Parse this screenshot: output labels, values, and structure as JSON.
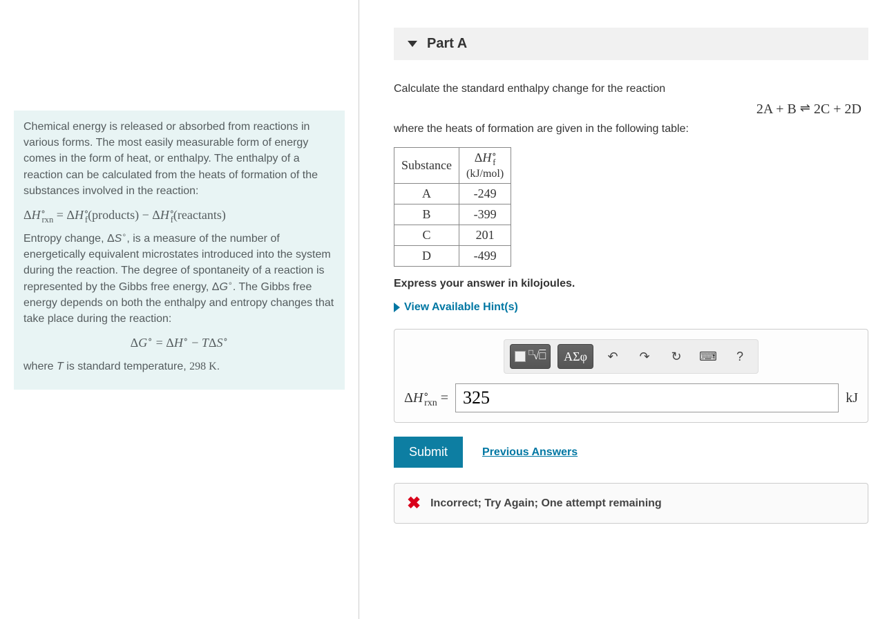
{
  "left": {
    "para1_a": "Chemical energy is released or absorbed from reactions in various forms. The most easily measurable form of energy comes in the form of heat, or enthalpy. The enthalpy of a reaction can be calculated from the heats of formation of the substances involved in the reaction:",
    "eq1": "ΔH°_rxn = ΔH°_f(products) − ΔH°_f(reactants)",
    "para2_a": "Entropy change, ",
    "para2_b": ", is a measure of the number of energetically equivalent microstates introduced into the system during the reaction. The degree of spontaneity of a reaction is represented by the Gibbs free energy, ",
    "para2_c": ". The Gibbs free energy depends on both the enthalpy and entropy changes that take place during the reaction:",
    "eq2": "ΔG° = ΔH° − TΔS°",
    "para3_a": "where ",
    "para3_b": " is standard temperature, ",
    "para3_c": "298 K",
    "para3_d": "."
  },
  "part": {
    "label": "Part A",
    "prompt_a": "Calculate the standard enthalpy change for the reaction",
    "equation": "2A + B ⇌ 2C + 2D",
    "prompt_b": "where the heats of formation are given in the following table:",
    "table": {
      "hdr_sub": "Substance",
      "hdr_val_sym": "ΔH°_f",
      "hdr_val_unit": "(kJ/mol)",
      "rows": [
        {
          "s": "A",
          "v": "-249"
        },
        {
          "s": "B",
          "v": "-399"
        },
        {
          "s": "C",
          "v": "201"
        },
        {
          "s": "D",
          "v": "-499"
        }
      ]
    },
    "instr": "Express your answer in kilojoules.",
    "hints": "View Available Hint(s)",
    "toolbar": {
      "greek": "ΑΣφ",
      "help": "?"
    },
    "answer": {
      "label": "ΔH°_rxn =",
      "value": "325",
      "unit": "kJ"
    },
    "submit": "Submit",
    "prev": "Previous Answers",
    "feedback": "Incorrect; Try Again; One attempt remaining"
  }
}
